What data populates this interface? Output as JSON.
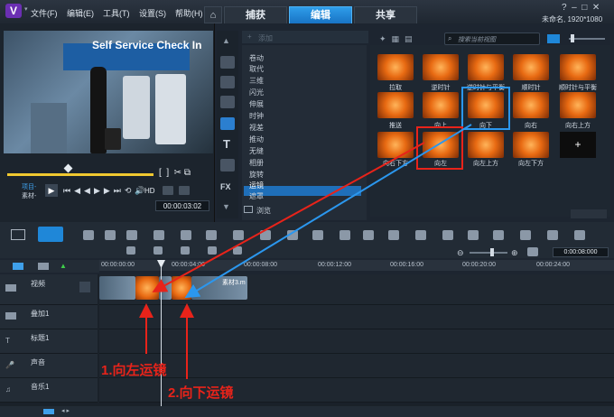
{
  "menubar": {
    "items": [
      "文件(F)",
      "编辑(E)",
      "工具(T)",
      "设置(S)",
      "帮助(H)"
    ]
  },
  "tabs": [
    "捕获",
    "编辑",
    "共享"
  ],
  "project_info": "未命名, 1920*1080",
  "preview": {
    "signage": "Self Service Check In",
    "mode_labels": [
      "项目-",
      "素材-"
    ],
    "hd": "HD",
    "timecode": "00:00:03:02"
  },
  "library": {
    "add_label": "添加",
    "search_placeholder": "搜索当前视图",
    "browse_label": "浏览",
    "categories": [
      "卷动",
      "取代",
      "三维",
      "闪光",
      "伸展",
      "时钟",
      "视差",
      "推动",
      "无缝",
      "相册",
      "旋转",
      "运镜",
      "遮罩"
    ],
    "selected_category": "运镜",
    "transitions": [
      "拉取",
      "逆时针",
      "逆时针与平衡",
      "顺时针",
      "顺时针与平衡",
      "推送",
      "向上",
      "向下",
      "向右",
      "向右上方",
      "向右下方",
      "向左",
      "向左上方",
      "向左下方"
    ],
    "highlighted_blue": "向下",
    "highlighted_red": "向左"
  },
  "timeline": {
    "zoom_time": "0:00:08:000",
    "ruler": [
      "00:00:00:00",
      "00:00:04:00",
      "00:00:08:00",
      "00:00:12:00",
      "00:00:16:00",
      "00:00:20:00",
      "00:00:24:00"
    ],
    "tracks": [
      "视频",
      "叠加1",
      "标题1",
      "声音",
      "音乐1"
    ],
    "clip_label": "素材3.m"
  },
  "annotations": {
    "label1": "1.向左运镜",
    "label2": "2.向下运镜"
  },
  "colors": {
    "accent": "#1f87d8",
    "red": "#e8231a",
    "orange": "#e86a12"
  }
}
